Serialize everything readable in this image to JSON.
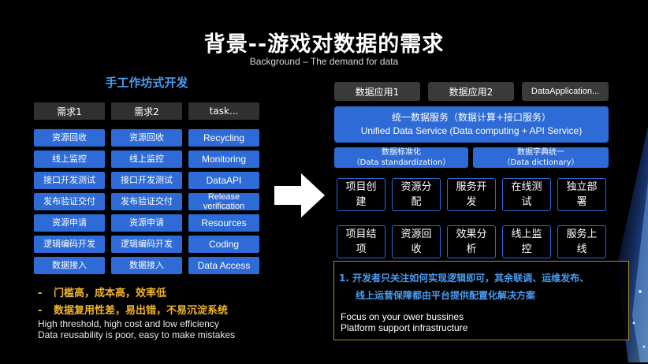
{
  "title": "背景--游戏对数据的需求",
  "subtitle": "Background – The demand for data",
  "left": {
    "heading": "手工作坊式开发",
    "columns": [
      {
        "header": "需求1",
        "items": [
          "资源回收",
          "线上监控",
          "接口开发测试",
          "发布验证交付",
          "资源申请",
          "逻辑编码开发",
          "数据接入"
        ]
      },
      {
        "header": "需求2",
        "items": [
          "资源回收",
          "线上监控",
          "接口开发测试",
          "发布验证交付",
          "资源申请",
          "逻辑编码开发",
          "数据接入"
        ]
      },
      {
        "header": "task...",
        "items": [
          "Recycling",
          "Monitoring",
          "DataAPI",
          "Release verification",
          "Resources",
          "Coding",
          "Data Access"
        ]
      }
    ],
    "bullets": [
      "门槛高，成本高，效率低",
      "数据复用性差，易出错，不易沉淀系统"
    ],
    "bullet_dash": "-",
    "notes": [
      "High threshold, high cost and low efficiency",
      "Data reusability is poor, easy to make mistakes"
    ]
  },
  "right": {
    "top_apps": [
      "数据应用1",
      "数据应用2",
      "DataApplication..."
    ],
    "uds": {
      "cn": "统一数据服务（数据计算+接口服务）",
      "en": "Unified Data Service (Data computing + API Service)"
    },
    "mid": [
      {
        "cn": "数据标准化",
        "en": "（Data standardization）"
      },
      {
        "cn": "数据字典统一",
        "en": "（Data dictionary）"
      }
    ],
    "row1": [
      [
        "项目创",
        "建"
      ],
      [
        "资源分",
        "配"
      ],
      [
        "服务开",
        "发"
      ],
      [
        "在线测",
        "试"
      ],
      [
        "独立部",
        "署"
      ]
    ],
    "row2": [
      [
        "项目结",
        "项"
      ],
      [
        "资源回",
        "收"
      ],
      [
        "效果分",
        "析"
      ],
      [
        "线上监",
        "控"
      ],
      [
        "服务上",
        "线"
      ]
    ],
    "info": {
      "line1": "1.  开发者只关注如何实现逻辑即可，其余联调、运维发布、",
      "line2": "线上运营保障都由平台提供配置化解决方案",
      "en1": "Focus on your ower bussines",
      "en2": "Platform support infrastructure"
    }
  },
  "colors": {
    "accent_blue": "#2e6bd6",
    "heading_blue": "#4a9df0",
    "bullet_yellow": "#f0b429",
    "header_gray": "#303030"
  },
  "icons": {
    "arrow": "right-arrow-icon",
    "decoration": "blue-light-streak"
  }
}
